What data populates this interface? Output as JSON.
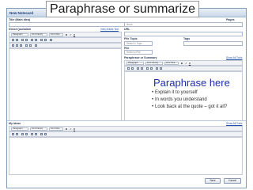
{
  "window": {
    "title": "New Notecard"
  },
  "overlay": {
    "heading": "Paraphrase or summarize"
  },
  "title_field": {
    "label": "Title (Main Idea)"
  },
  "pages": {
    "label": "Pages",
    "value": "None"
  },
  "url": {
    "label": "URL"
  },
  "direct_quotation": {
    "label": "Direct Quotation",
    "link": "View Article Text"
  },
  "pile_topic": {
    "label": "Pile Topic",
    "value": "Select a Topic"
  },
  "tags": {
    "label": "Tags"
  },
  "pile": {
    "label": "Pile",
    "value": "Select a Pile"
  },
  "paraphrase": {
    "label": "Paraphrase or Summary",
    "link": "Show All Tools"
  },
  "my_ideas": {
    "label": "My Ideas",
    "link": "Show All Tools"
  },
  "toolbar": {
    "format": "Paragraph",
    "font": "Font Family",
    "size": "Font Size",
    "bold": "B",
    "italic": "I",
    "underline": "U"
  },
  "guidance": {
    "title": "Paraphrase here",
    "items": [
      "Explain it to yourself",
      "In words you understand",
      "Look back at the quote – got it all?"
    ]
  },
  "buttons": {
    "save": "Save",
    "cancel": "Cancel"
  }
}
